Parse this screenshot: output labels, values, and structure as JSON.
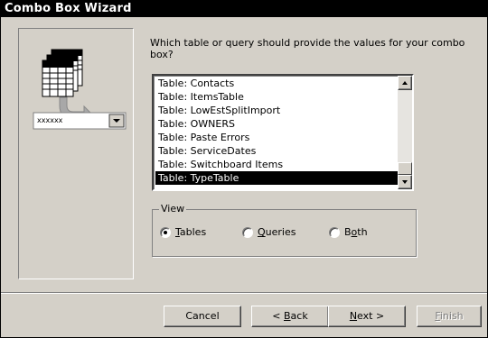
{
  "window": {
    "title": "Combo Box Wizard"
  },
  "illustration": {
    "combo_value": "xxxxxx"
  },
  "question": "Which table or query should provide the values for your combo box?",
  "listbox": {
    "items": [
      "Table: Contacts",
      "Table: ItemsTable",
      "Table: LowEstSplitImport",
      "Table: OWNERS",
      "Table: Paste Errors",
      "Table: ServiceDates",
      "Table: Switchboard Items",
      "Table: TypeTable"
    ],
    "selected_index": 7
  },
  "view": {
    "label": "View",
    "options": [
      {
        "pre": "",
        "key": "T",
        "post": "ables",
        "selected": true
      },
      {
        "pre": "",
        "key": "Q",
        "post": "ueries",
        "selected": false
      },
      {
        "pre": "B",
        "key": "o",
        "post": "th",
        "selected": false
      }
    ]
  },
  "buttons": {
    "cancel": {
      "pre": "Cancel",
      "key": "",
      "post": ""
    },
    "back": {
      "pre": "< ",
      "key": "B",
      "post": "ack"
    },
    "next": {
      "pre": "",
      "key": "N",
      "post": "ext >"
    },
    "finish": {
      "pre": "",
      "key": "F",
      "post": "inish",
      "disabled": true
    }
  }
}
